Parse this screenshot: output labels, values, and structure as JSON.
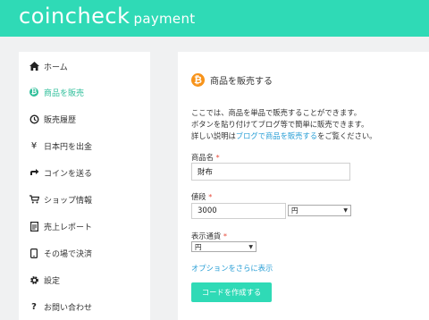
{
  "brand": {
    "name": "coincheck",
    "product": "payment"
  },
  "nav": {
    "items": [
      {
        "label": "ホーム",
        "icon": "home-icon"
      },
      {
        "label": "商品を販売",
        "icon": "bitcoin-icon",
        "active": true
      },
      {
        "label": "販売履歴",
        "icon": "history-icon"
      },
      {
        "label": "日本円を出金",
        "icon": "yen-icon"
      },
      {
        "label": "コインを送る",
        "icon": "send-icon"
      },
      {
        "label": "ショップ情報",
        "icon": "shop-icon"
      },
      {
        "label": "売上レポート",
        "icon": "report-icon"
      },
      {
        "label": "その場で決済",
        "icon": "mobile-icon"
      },
      {
        "label": "設定",
        "icon": "gear-icon"
      },
      {
        "label": "お問い合わせ",
        "icon": "help-icon"
      }
    ]
  },
  "main": {
    "title": "商品を販売する",
    "desc_line1": "ここでは、商品を単品で販売することができます。",
    "desc_line2": "ボタンを貼り付けてブログ等で簡単に販売できます。",
    "desc_line3_pre": "詳しい説明は",
    "desc_line3_link": "ブログで商品を販売する",
    "desc_line3_post": "をご覧ください。",
    "fields": {
      "name_label": "商品名",
      "name_value": "財布",
      "price_label": "値段",
      "price_value": "3000",
      "price_currency": "円",
      "display_label": "表示通貨",
      "display_currency": "円",
      "required_mark": "*"
    },
    "more_options": "オプションをさらに表示",
    "submit": "コードを作成する"
  },
  "colors": {
    "accent": "#2fdab6",
    "link": "#2a9fd6",
    "bitcoin": "#f7931a",
    "required": "#e74c3c"
  }
}
